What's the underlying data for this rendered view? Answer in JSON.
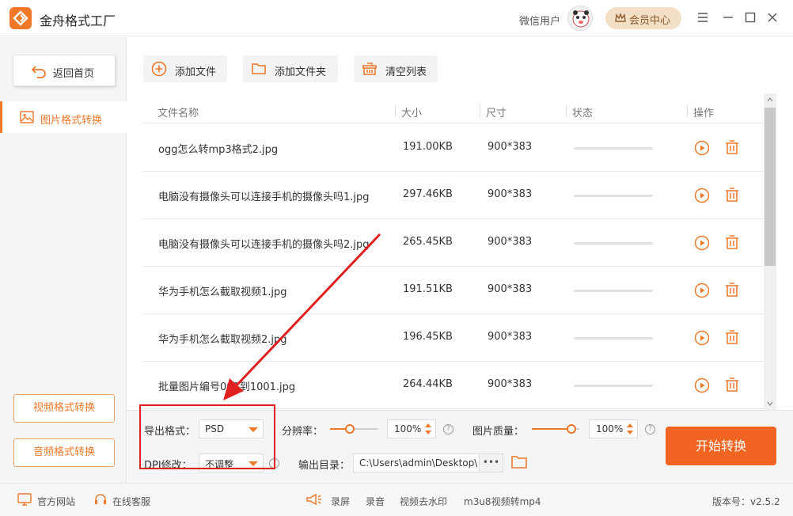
{
  "app": {
    "title": "金舟格式工厂"
  },
  "header": {
    "user_name": "微信用户",
    "vip_label": "会员中心"
  },
  "sidebar": {
    "back_label": "返回首页",
    "active_item": "图片格式转换",
    "buttons": [
      "视频格式转换",
      "音频格式转换"
    ]
  },
  "toolbar": {
    "add_file": "添加文件",
    "add_folder": "添加文件夹",
    "clear_list": "清空列表"
  },
  "table": {
    "columns": [
      "文件名称",
      "大小",
      "尺寸",
      "状态",
      "操作"
    ],
    "rows": [
      {
        "name": "ogg怎么转mp3格式2.jpg",
        "size": "191.00KB",
        "dims": "900*383",
        "progress": 0
      },
      {
        "name": "电脑没有摄像头可以连接手机的摄像头吗1.jpg",
        "size": "297.46KB",
        "dims": "900*383",
        "progress": 0
      },
      {
        "name": "电脑没有摄像头可以连接手机的摄像头吗2.jpg",
        "size": "265.45KB",
        "dims": "900*383",
        "progress": 0
      },
      {
        "name": "华为手机怎么截取视频1.jpg",
        "size": "191.51KB",
        "dims": "900*383",
        "progress": 0
      },
      {
        "name": "华为手机怎么截取视频2.jpg",
        "size": "196.45KB",
        "dims": "900*383",
        "progress": 0
      },
      {
        "name": "批量图片编号001到1001.jpg",
        "size": "264.44KB",
        "dims": "900*383",
        "progress": 0
      }
    ]
  },
  "settings": {
    "export_format_label": "导出格式：",
    "export_format_value": "PSD",
    "resolution_label": "分辨率：",
    "resolution_value": "100",
    "resolution_unit": "%",
    "quality_label": "图片质量：",
    "quality_value": "100",
    "quality_unit": "%",
    "dpi_label": "DPI修改：",
    "dpi_value": "不调整",
    "output_label": "输出目录：",
    "output_path": "C:\\Users\\admin\\Desktop\\",
    "output_more": "•••",
    "help_glyph": "?",
    "start_label": "开始转换"
  },
  "statusbar": {
    "website": "官方网站",
    "support": "在线客服",
    "links": [
      "录屏",
      "录音",
      "视频去水印",
      "m3u8视频转mp4"
    ],
    "version": "版本号：v2.5.2"
  },
  "colors": {
    "accent": "#f07828",
    "start": "#f26422",
    "highlight": "#e02020"
  }
}
